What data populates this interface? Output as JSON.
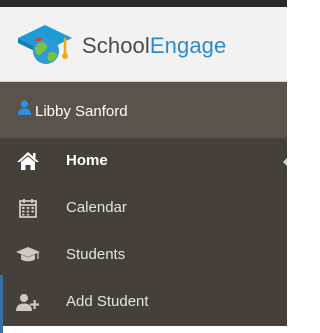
{
  "brand": {
    "name_part1": "School",
    "name_part2": "Engage",
    "logo_icon": "graduation-cap-globe-logo"
  },
  "user": {
    "name": "Libby Sanford",
    "icon": "user-icon"
  },
  "nav": {
    "items": [
      {
        "label": "Home",
        "icon": "home-icon",
        "active": true
      },
      {
        "label": "Calendar",
        "icon": "calendar-icon",
        "active": false
      },
      {
        "label": "Students",
        "icon": "graduation-cap-icon",
        "active": false
      },
      {
        "label": "Add Student",
        "icon": "add-user-icon",
        "active": false
      }
    ]
  },
  "colors": {
    "sidebar_bg": "#46403b",
    "userbar_bg": "#5a534c",
    "brand_accent": "#2a8bd8",
    "user_icon": "#2f8fe0"
  }
}
